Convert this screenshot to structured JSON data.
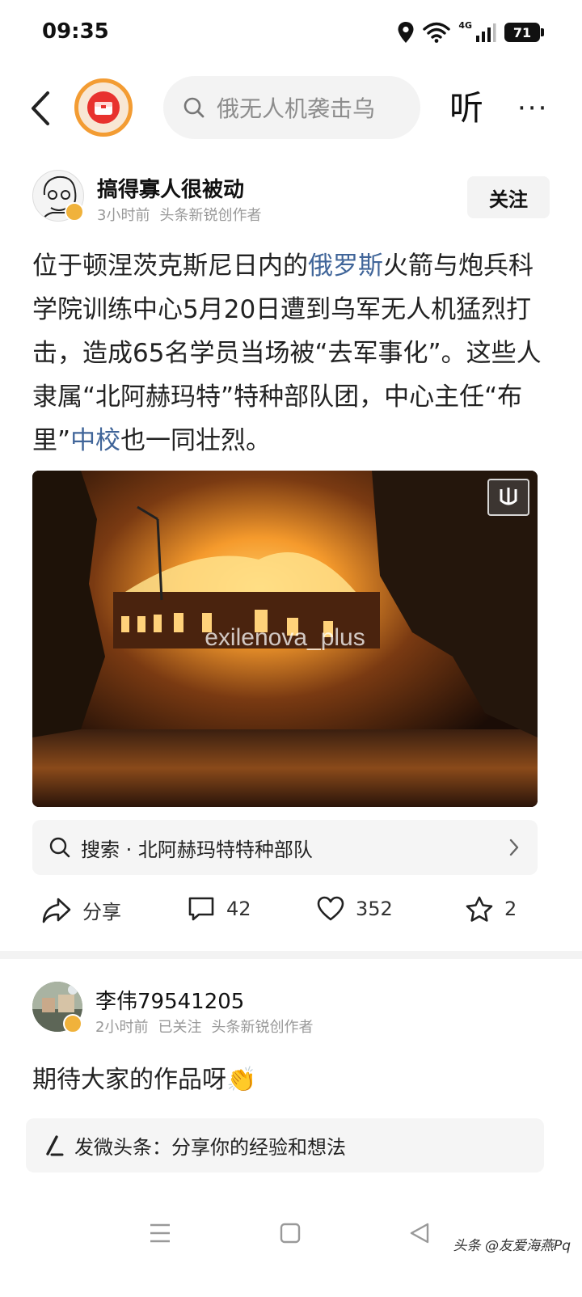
{
  "status_bar": {
    "time": "09:35",
    "network": "4G",
    "battery": "71"
  },
  "top_nav": {
    "search_placeholder": "俄无人机袭击乌",
    "listen_label": "听",
    "more_label": "···"
  },
  "author": {
    "name": "搞得寡人很被动",
    "time": "3小时前",
    "tag": "头条新锐创作者",
    "follow_label": "关注"
  },
  "article": {
    "part1": "位于顿涅茨克斯尼日内的",
    "link1": "俄罗斯",
    "part2": "火箭与炮兵科学院训练中心5月20日遭到乌军无人机猛烈打击，造成65名学员当场被“去军事化”。这些人隶属“北阿赫玛特”特种部队团，中心主任“布里”",
    "link2": "中校",
    "part3": "也一同壮烈。"
  },
  "image": {
    "watermark": "exilenova_plus"
  },
  "related_search": {
    "label": "搜索 · 北阿赫玛特特种部队"
  },
  "actions": {
    "share_label": "分享",
    "comments": "42",
    "likes": "352",
    "favorites": "2"
  },
  "comment": {
    "name": "李伟79541205",
    "time": "2小时前",
    "status": "已关注",
    "tag": "头条新锐创作者",
    "text": "期待大家的作品呀👏"
  },
  "post_box": {
    "label": "发微头条：分享你的经验和想法"
  },
  "credit": "头条 @友爱海燕Pq",
  "colors": {
    "link": "#406599",
    "logo_red": "#e8322e",
    "logo_orange": "#f39c33",
    "badge": "#f0b23b"
  }
}
